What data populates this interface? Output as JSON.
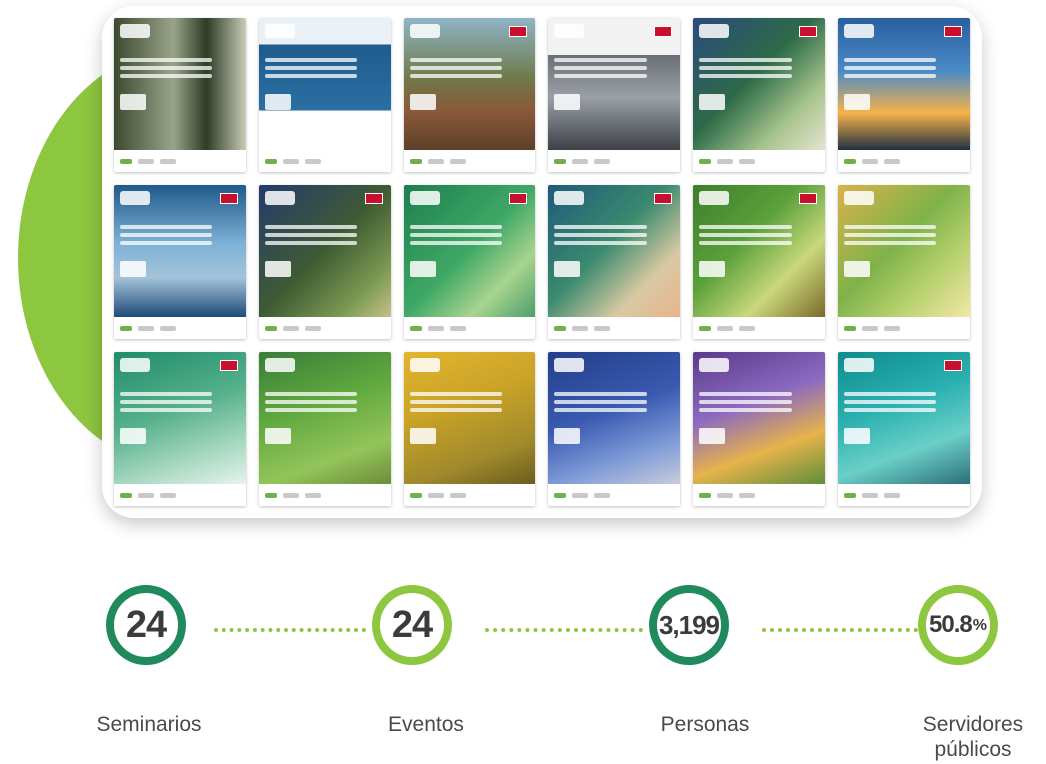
{
  "stats": [
    {
      "value": "24",
      "label": "Seminarios"
    },
    {
      "value": "24",
      "label": "Eventos"
    },
    {
      "value": "3,199",
      "label": "Personas"
    },
    {
      "value": "50.8",
      "unit": "%",
      "label_line1": "Servidores",
      "label_line2": "públicos"
    }
  ],
  "colors": {
    "accent_dark_green": "#1f8a5c",
    "accent_light_green": "#8dc63f"
  }
}
